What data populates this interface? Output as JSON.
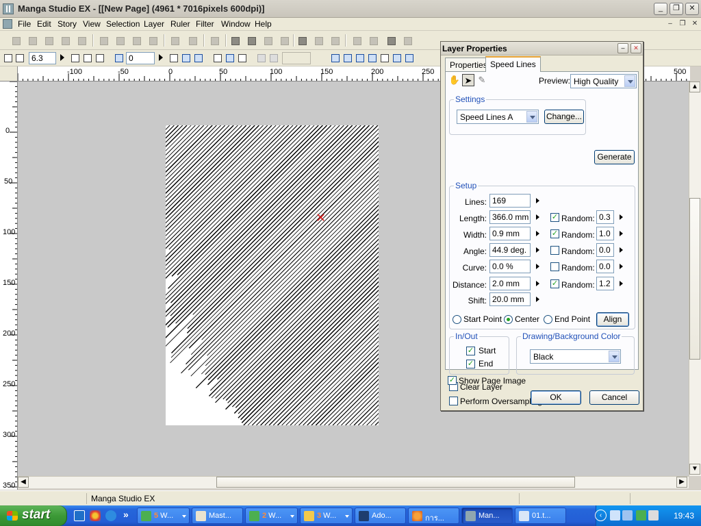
{
  "window": {
    "title": "Manga Studio EX - [[New Page] (4961 * 7016pixels 600dpi)]",
    "minimize": "_",
    "maximize": "❐",
    "close": "✕"
  },
  "menu": {
    "items": [
      "File",
      "Edit",
      "Story",
      "View",
      "Selection",
      "Layer",
      "Ruler",
      "Filter",
      "Window",
      "Help"
    ]
  },
  "toolbar2": {
    "zoom_value": "6.3",
    "rotate_value": "0"
  },
  "rulers": {
    "horizontal": [
      "-100",
      "-50",
      "0",
      "50",
      "100",
      "150",
      "200",
      "250",
      "500"
    ],
    "vertical": [
      "0",
      "50",
      "100",
      "150",
      "200",
      "250",
      "300",
      "350"
    ]
  },
  "status": {
    "text": "Manga Studio EX"
  },
  "dialog": {
    "title": "Layer Properties",
    "tabs": [
      "Properties",
      "Speed Lines"
    ],
    "preview_label": "Preview:",
    "preview_value": "High Quality",
    "settings": {
      "title": "Settings",
      "preset": "Speed Lines A",
      "change_label": "Change...",
      "generate_label": "Generate"
    },
    "setup": {
      "title": "Setup",
      "lines_label": "Lines:",
      "lines_value": "169",
      "length_label": "Length:",
      "length_value": "366.0 mm",
      "width_label": "Width:",
      "width_value": "0.9 mm",
      "angle_label": "Angle:",
      "angle_value": "44.9 deg.",
      "curve_label": "Curve:",
      "curve_value": "0.0 %",
      "distance_label": "Distance:",
      "distance_value": "2.0 mm",
      "shift_label": "Shift:",
      "shift_value": "20.0 mm",
      "random_label": "Random:",
      "random_length": "0.3",
      "random_width": "1.0",
      "random_angle": "0.0",
      "random_curve": "0.0",
      "random_distance": "1.2",
      "start_point": "Start Point",
      "center": "Center",
      "end_point": "End Point",
      "align_label": "Align"
    },
    "inout": {
      "title": "In/Out",
      "start": "Start",
      "end": "End"
    },
    "color": {
      "title": "Drawing/Background Color",
      "value": "Black"
    },
    "clear_layer": "Clear Layer",
    "perform_oversampling": "Perform Oversampling",
    "show_page_image": "Show Page Image",
    "ok_label": "OK",
    "cancel_label": "Cancel"
  },
  "taskbar": {
    "start_label": "start",
    "tasks": [
      {
        "num": "5",
        "label": " W..."
      },
      {
        "num": "",
        "label": "Mast..."
      },
      {
        "num": "2",
        "label": " W..."
      },
      {
        "num": "3",
        "label": " W..."
      },
      {
        "num": "",
        "label": "Ado..."
      },
      {
        "num": "",
        "label": "การ..."
      },
      {
        "num": "",
        "label": "Man..."
      },
      {
        "num": "",
        "label": "01.t..."
      }
    ],
    "clock": "19:43"
  }
}
